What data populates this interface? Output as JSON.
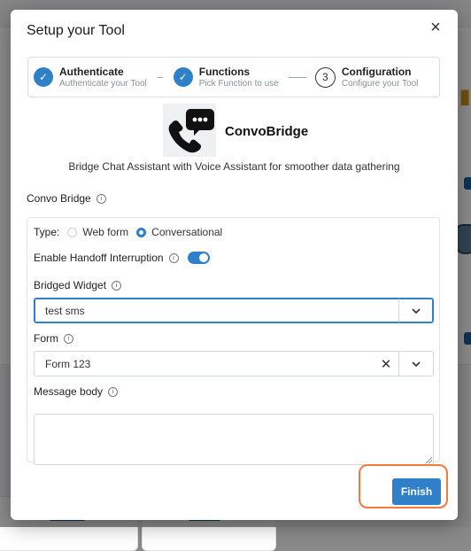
{
  "modal": {
    "title": "Setup your Tool",
    "close_symbol": "×"
  },
  "stepper": {
    "steps": [
      {
        "title": "Authenticate",
        "subtitle": "Authenticate your Tool",
        "state": "done",
        "marker": "✓"
      },
      {
        "title": "Functions",
        "subtitle": "Pick Function to use",
        "state": "done",
        "marker": "✓"
      },
      {
        "title": "Configuration",
        "subtitle": "Configure your Tool",
        "state": "current",
        "marker": "3"
      }
    ]
  },
  "app": {
    "name": "ConvoBridge",
    "description": "Bridge Chat Assistant with Voice Assistant for smoother data gathering",
    "logo_icon": "phone-chat-icon"
  },
  "section": {
    "label": "Convo Bridge"
  },
  "form": {
    "type": {
      "label": "Type:",
      "options": [
        "Web form",
        "Conversational"
      ],
      "selected": "Conversational"
    },
    "handoff": {
      "label": "Enable Handoff Interruption",
      "enabled": true
    },
    "bridged_widget": {
      "label": "Bridged Widget",
      "value": "test sms"
    },
    "form_select": {
      "label": "Form",
      "value": "Form 123"
    },
    "message_body": {
      "label": "Message body",
      "value": ""
    }
  },
  "footer": {
    "finish_label": "Finish"
  },
  "colors": {
    "accent": "#2f80c8",
    "highlight": "#f27b3c"
  }
}
